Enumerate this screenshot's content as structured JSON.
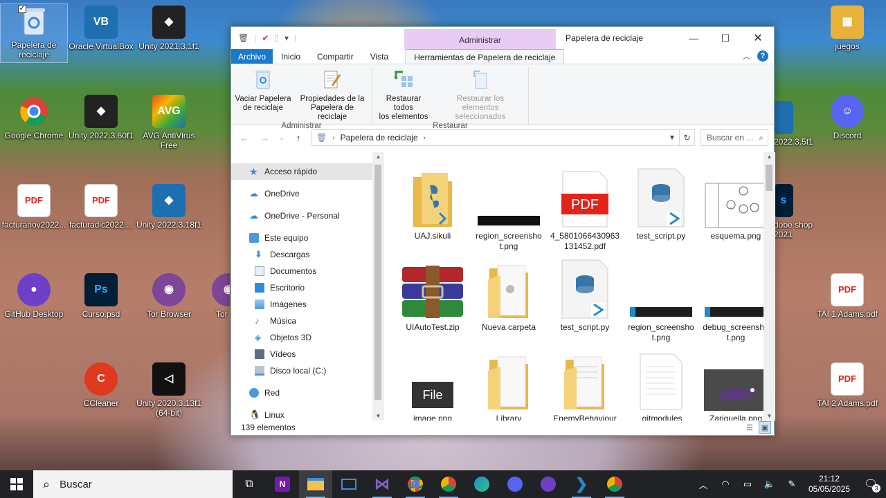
{
  "desktop": {
    "left_icons": [
      {
        "label": "Papelera de reciclaje",
        "icon": "recycle-bin-icon",
        "color": "#7aa7d8"
      },
      {
        "label": "Oracle VirtualBox",
        "icon": "virtualbox-icon",
        "color": "#1e6fb0"
      },
      {
        "label": "Unity 2021.3.1f1",
        "icon": "unity-icon",
        "color": "#222222"
      },
      {
        "label": "Google Chrome",
        "icon": "chrome-icon",
        "color": "#db4437"
      },
      {
        "label": "Unity 2022.3.60f1",
        "icon": "unity-icon",
        "color": "#222222"
      },
      {
        "label": "AVG AntiVirus Free",
        "icon": "avg-icon",
        "color": "#e84f1c"
      },
      {
        "label": "facturanov2022...",
        "icon": "pdf-icon",
        "color": "#e2231a"
      },
      {
        "label": "facturadic2022....",
        "icon": "pdf-icon",
        "color": "#e2231a"
      },
      {
        "label": "Unity 2022.3.18f1",
        "icon": "unity-icon",
        "color": "#1e6fb0"
      },
      {
        "label": "GitHub Desktop",
        "icon": "github-desktop-icon",
        "color": "#6e40c9"
      },
      {
        "label": "Curso.psd",
        "icon": "psd-icon",
        "color": "#001e36"
      },
      {
        "label": "Tor Browser",
        "icon": "tor-icon",
        "color": "#7d4698"
      },
      {
        "label": "Tor",
        "icon": "tor-icon",
        "color": "#7d4698"
      },
      {
        "label": "CCleaner",
        "icon": "ccleaner-icon",
        "color": "#e03a1e"
      },
      {
        "label": "Unity 2020.3.13f1 (64-bit)",
        "icon": "unity-icon",
        "color": "#111111"
      }
    ],
    "right_icons": [
      {
        "label": "juegos",
        "icon": "folder-icon",
        "color": "#e8b23a"
      },
      {
        "label": "2022.3.5f1",
        "icon": "unity-icon",
        "color": "#1e6fb0"
      },
      {
        "label": "Discord",
        "icon": "discord-icon",
        "color": "#5865f2"
      },
      {
        "label": "dobe shop 2021",
        "icon": "photoshop-icon",
        "color": "#001e36"
      },
      {
        "label": "TAI 1 Adams.pdf",
        "icon": "pdf-icon",
        "color": "#e2231a"
      },
      {
        "label": "TAI 2 Adams.pdf",
        "icon": "pdf-icon",
        "color": "#e2231a"
      }
    ]
  },
  "window": {
    "title": "Papelera de reciclaje",
    "context_tab_group": "Administrar",
    "ribbon_tabs": [
      "Archivo",
      "Inicio",
      "Compartir",
      "Vista",
      "Herramientas de Papelera de reciclaje"
    ],
    "ribbon_groups": [
      {
        "label": "Administrar",
        "buttons": [
          {
            "label": "Vaciar Papelera de reciclaje",
            "line1": "Vaciar Papelera",
            "line2": "de reciclaje",
            "enabled": true
          },
          {
            "label": "Propiedades de la Papelera de reciclaje",
            "line1": "Propiedades de la",
            "line2": "Papelera de reciclaje",
            "enabled": true
          }
        ]
      },
      {
        "label": "Restaurar",
        "buttons": [
          {
            "label": "Restaurar todos los elementos",
            "line1": "Restaurar todos",
            "line2": "los elementos",
            "enabled": true
          },
          {
            "label": "Restaurar los elementos seleccionados",
            "line1": "Restaurar los elementos",
            "line2": "seleccionados",
            "enabled": false
          }
        ]
      }
    ],
    "address": {
      "path": "Papelera de reciclaje",
      "search_placeholder": "Buscar en ..."
    },
    "nav_pane": [
      {
        "label": "Acceso rápido",
        "icon": "star-icon",
        "level": 0,
        "selected": true
      },
      {
        "label": "OneDrive",
        "icon": "cloud-icon",
        "level": 0
      },
      {
        "label": "OneDrive - Personal",
        "icon": "cloud-icon",
        "level": 0
      },
      {
        "label": "Este equipo",
        "icon": "computer-icon",
        "level": 0
      },
      {
        "label": "Descargas",
        "icon": "download-icon",
        "level": 1
      },
      {
        "label": "Documentos",
        "icon": "document-icon",
        "level": 1
      },
      {
        "label": "Escritorio",
        "icon": "desktop-icon",
        "level": 1
      },
      {
        "label": "Imágenes",
        "icon": "pictures-icon",
        "level": 1
      },
      {
        "label": "Música",
        "icon": "music-icon",
        "level": 1
      },
      {
        "label": "Objetos 3D",
        "icon": "cube-icon",
        "level": 1
      },
      {
        "label": "Vídeos",
        "icon": "video-icon",
        "level": 1
      },
      {
        "label": "Disco local (C:)",
        "icon": "drive-icon",
        "level": 1
      },
      {
        "label": "Red",
        "icon": "network-icon",
        "level": 0
      },
      {
        "label": "Linux",
        "icon": "linux-icon",
        "level": 0
      }
    ],
    "files": [
      {
        "line1": "UAJ.sikuli",
        "line2": "",
        "kind": "folder-python"
      },
      {
        "line1": "region_screensho",
        "line2": "t.png",
        "kind": "screenshot-dark"
      },
      {
        "line1": "4_5801066430963",
        "line2": "131452.pdf",
        "kind": "pdf"
      },
      {
        "line1": "test_script.py",
        "line2": "",
        "kind": "python"
      },
      {
        "line1": "esquema.png",
        "line2": "",
        "kind": "sketch"
      },
      {
        "line1": "UIAutoTest.zip",
        "line2": "",
        "kind": "zip"
      },
      {
        "line1": "Nueva carpeta",
        "line2": "",
        "kind": "folder"
      },
      {
        "line1": "test_script.py",
        "line2": "",
        "kind": "python"
      },
      {
        "line1": "region_screensho",
        "line2": "t.png",
        "kind": "screenshot-vscode"
      },
      {
        "line1": "debug_screensho",
        "line2": "t.png",
        "kind": "screenshot-vscode"
      },
      {
        "line1": "image.png",
        "line2": "",
        "kind": "file-badge",
        "badge": "File"
      },
      {
        "line1": "Library",
        "line2": "",
        "kind": "folder"
      },
      {
        "line1": "EnemyBehaviour",
        "line2": "",
        "kind": "folder-docs"
      },
      {
        "line1": ".gitmodules",
        "line2": "",
        "kind": "textfile"
      },
      {
        "line1": "Zariguella.png",
        "line2": "",
        "kind": "sprite"
      }
    ],
    "status": "139 elementos"
  },
  "taskbar": {
    "search_placeholder": "Buscar",
    "apps": [
      {
        "name": "task-view-icon",
        "color": "#ffffff"
      },
      {
        "name": "onenote-icon",
        "color": "#7719aa"
      },
      {
        "name": "file-explorer-icon",
        "color": "#f2c14e",
        "active": true
      },
      {
        "name": "remote-desktop-icon",
        "color": "#3a8de0"
      },
      {
        "name": "visual-studio-icon",
        "color": "#8661c5"
      },
      {
        "name": "chrome-icon",
        "color": "#db4437"
      },
      {
        "name": "chrome-profile-icon",
        "color": "#1aa260"
      },
      {
        "name": "edge-icon",
        "color": "#1a8fd8"
      },
      {
        "name": "discord-icon",
        "color": "#5865f2"
      },
      {
        "name": "github-desktop-icon",
        "color": "#6e40c9"
      },
      {
        "name": "vscode-icon",
        "color": "#2489ca"
      },
      {
        "name": "chrome-user-icon",
        "color": "#db4437"
      }
    ],
    "time": "21:12",
    "date": "05/05/2025",
    "notification_count": "3"
  }
}
